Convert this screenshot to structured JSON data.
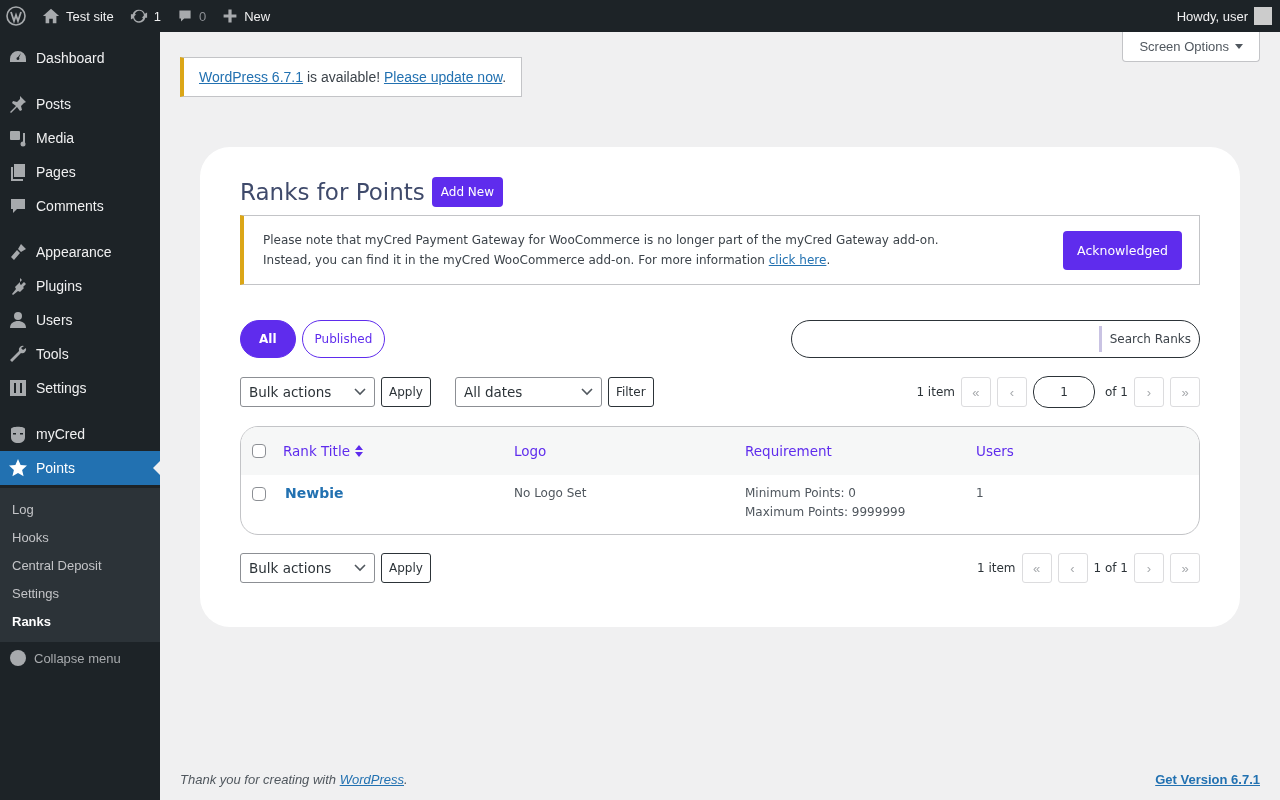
{
  "admin_bar": {
    "site": "Test site",
    "updates": "1",
    "comments": "0",
    "new": "New",
    "greeting": "Howdy, user"
  },
  "sidebar": {
    "groups": [
      [
        {
          "label": "Dashboard",
          "selected": false
        }
      ],
      [
        {
          "label": "Posts",
          "selected": false
        },
        {
          "label": "Media",
          "selected": false
        },
        {
          "label": "Pages",
          "selected": false
        },
        {
          "label": "Comments",
          "selected": false
        }
      ],
      [
        {
          "label": "Appearance",
          "selected": false
        },
        {
          "label": "Plugins",
          "selected": false
        },
        {
          "label": "Users",
          "selected": false
        },
        {
          "label": "Tools",
          "selected": false
        },
        {
          "label": "Settings",
          "selected": false
        }
      ],
      [
        {
          "label": "myCred",
          "selected": false
        },
        {
          "label": "Points",
          "selected": true
        }
      ]
    ],
    "submenu": [
      {
        "label": "Log",
        "selected": false
      },
      {
        "label": "Hooks",
        "selected": false
      },
      {
        "label": "Central Deposit",
        "selected": false
      },
      {
        "label": "Settings",
        "selected": false
      },
      {
        "label": "Ranks",
        "selected": true
      }
    ],
    "collapse": "Collapse menu"
  },
  "screen_options": "Screen Options",
  "update_notice": {
    "link": "WordPress 6.7.1",
    "text": " is available! ",
    "action": "Please update now",
    "end": "."
  },
  "heading": "Ranks for Points",
  "add_new": "Add New",
  "notice": {
    "line1": "Please note that myCred Payment Gateway for WooCommerce is no longer part of the myCred Gateway add-on.",
    "line2": {
      "text": "Instead, you can find it in the myCred WooCommerce add-on. For more information ",
      "link": "click here",
      "end": "."
    },
    "button": "Acknowledged"
  },
  "filters": [
    {
      "label": "All",
      "selected": true
    },
    {
      "label": "Published",
      "selected": false
    }
  ],
  "search_button": "Search Ranks",
  "top_nav": {
    "bulk": "Bulk actions",
    "apply": "Apply",
    "dates": "All dates",
    "filter": "Filter",
    "count": "1 item",
    "page": "1",
    "of": "of 1",
    "first": [
      {
        "label": "«",
        "disabled": true
      },
      {
        "label": "‹",
        "disabled": true
      }
    ],
    "last": [
      {
        "label": "›",
        "disabled": true
      },
      {
        "label": "»",
        "disabled": true
      }
    ]
  },
  "table": {
    "select_all_checked": false,
    "columns": [
      "Rank Title",
      "Logo",
      "Requirement",
      "Users"
    ],
    "rows": [
      {
        "checked": false,
        "title": "Newbie",
        "logo": "No Logo Set",
        "requirement": [
          "Minimum Points: 0",
          "Maximum Points: 9999999"
        ],
        "users": "1"
      }
    ]
  },
  "bottom_nav": {
    "bulk": "Bulk actions",
    "apply": "Apply",
    "count": "1 item",
    "pages": "1 of 1",
    "first": [
      {
        "label": "«",
        "disabled": true
      },
      {
        "label": "‹",
        "disabled": true
      }
    ],
    "last": [
      {
        "label": "›",
        "disabled": true
      },
      {
        "label": "»",
        "disabled": true
      }
    ]
  },
  "footer": {
    "thanks": {
      "text": "Thank you for creating with ",
      "link": "WordPress",
      "end": "."
    },
    "version": "Get Version 6.7.1"
  }
}
